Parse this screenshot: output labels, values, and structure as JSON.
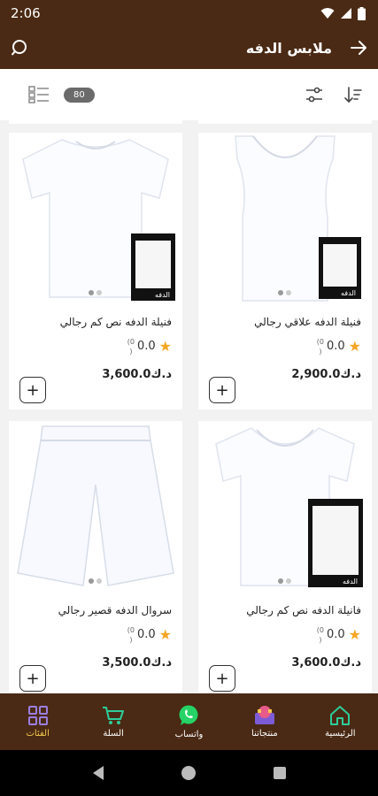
{
  "status_bar": {
    "time": "2:06"
  },
  "app_bar": {
    "title": "ملابس الدفه"
  },
  "toolbar": {
    "count": "80"
  },
  "products": [
    {
      "name": "فنيلة الدفه علاقي رجالي",
      "rating": "0.0",
      "reviews": "(0",
      "reviews_close": ")",
      "price": "2,900.0",
      "currency": "د.ك",
      "image": "tank-top"
    },
    {
      "name": "فنيلة الدفه نص كم رجالي",
      "rating": "0.0",
      "reviews": "(0",
      "reviews_close": ")",
      "price": "3,600.0",
      "currency": "د.ك",
      "image": "crew-tshirt"
    },
    {
      "name": "فانيلة الدفه نص كم رجالي",
      "rating": "0.0",
      "reviews": "(0",
      "reviews_close": ")",
      "price": "3,600.0",
      "currency": "د.ك",
      "image": "v-neck-tshirt"
    },
    {
      "name": "سروال الدفه قصير رجالي",
      "rating": "0.0",
      "reviews": "(0",
      "reviews_close": ")",
      "price": "3,500.0",
      "currency": "د.ك",
      "image": "shorts"
    }
  ],
  "package_label": "الدفه",
  "bottom_nav": [
    {
      "label": "الرئيسية",
      "icon": "home-icon"
    },
    {
      "label": "منتجاتنا",
      "icon": "products-icon"
    },
    {
      "label": "واتساب",
      "icon": "whatsapp-icon"
    },
    {
      "label": "السلة",
      "icon": "cart-icon"
    },
    {
      "label": "الفئات",
      "icon": "categories-icon"
    }
  ],
  "colors": {
    "brand": "#4a2a14",
    "accent": "#f2c94c",
    "star": "#f5a623"
  }
}
